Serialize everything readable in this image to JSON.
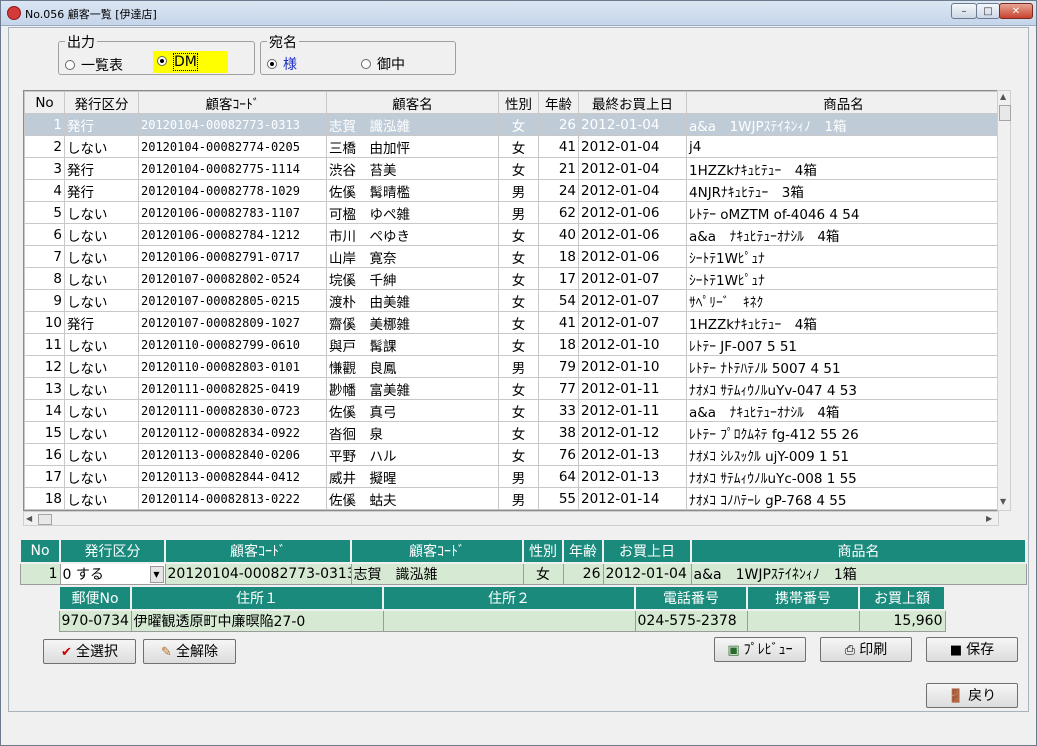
{
  "window": {
    "title": "No.056 顧客一覧 [伊達店]",
    "min": "–",
    "max": "□",
    "close": "✕"
  },
  "output_group": {
    "label": "出力",
    "options": [
      "一覧表",
      "DM"
    ],
    "selected": "DM"
  },
  "address_group": {
    "label": "宛名",
    "options": [
      "様",
      "御中"
    ],
    "selected": "様"
  },
  "grid": {
    "columns": [
      "No",
      "発行区分",
      "顧客ｺｰﾄﾞ",
      "顧客名",
      "性別",
      "年齢",
      "最終お買上日",
      "商品名"
    ],
    "rows": [
      [
        "1",
        "発行",
        "20120104-00082773-0313",
        "志賀　識泓雑",
        "女",
        "26",
        "2012-01-04",
        "a&a　1WJPｽﾃｲﾈﾝｨﾉ　1箱"
      ],
      [
        "2",
        "しない",
        "20120104-00082774-0205",
        "三橋　由加怦",
        "女",
        "41",
        "2012-01-04",
        "j4"
      ],
      [
        "3",
        "発行",
        "20120104-00082775-1114",
        "渋谷　苔美",
        "女",
        "21",
        "2012-01-04",
        "1HZZkﾅｷｭﾋﾃｭｰ　4箱"
      ],
      [
        "4",
        "発行",
        "20120104-00082778-1029",
        "佐傒　髯晴檻",
        "男",
        "24",
        "2012-01-04",
        "4NJRﾅｷｭﾋﾃｭｰ　3箱"
      ],
      [
        "5",
        "しない",
        "20120106-00082783-1107",
        "可楹　ゆペ雑",
        "男",
        "62",
        "2012-01-06",
        "ﾚﾄﾃｰ oMZTM of-4046 4 54"
      ],
      [
        "6",
        "しない",
        "20120106-00082784-1212",
        "市川　ぺゆき",
        "女",
        "40",
        "2012-01-06",
        "a&a　ﾅｷｭﾋﾃｭｰｵﾅｼﾙ　4箱"
      ],
      [
        "7",
        "しない",
        "20120106-00082791-0717",
        "山岸　寛奈",
        "女",
        "18",
        "2012-01-06",
        "ｼｰﾄﾃ1Wﾋﾟｭﾅ"
      ],
      [
        "8",
        "しない",
        "20120107-00082802-0524",
        "垸傒　千紳",
        "女",
        "17",
        "2012-01-07",
        "ｼｰﾄﾃ1Wﾋﾟｭﾅ"
      ],
      [
        "9",
        "しない",
        "20120107-00082805-0215",
        "渡朴　由美雑",
        "女",
        "54",
        "2012-01-07",
        "ｻﾍﾟﾘｰﾞ　ｷﾈｸ"
      ],
      [
        "10",
        "発行",
        "20120107-00082809-1027",
        "齋傒　美梛雑",
        "女",
        "41",
        "2012-01-07",
        "1HZZkﾅｷｭﾋﾃｭｰ　4箱"
      ],
      [
        "11",
        "しない",
        "20120110-00082799-0610",
        "與戸　髯課",
        "女",
        "18",
        "2012-01-10",
        "ﾚﾄﾃｰ JF-007 5 51"
      ],
      [
        "12",
        "しない",
        "20120110-00082803-0101",
        "慊觀　良鳳",
        "男",
        "79",
        "2012-01-10",
        "ﾚﾄﾃｰ ﾅﾄﾃﾊﾃﾉﾙ 5007 4 51"
      ],
      [
        "13",
        "しない",
        "20120111-00082825-0419",
        "尠幡　富美雑",
        "女",
        "77",
        "2012-01-11",
        "ﾅｵﾒｺ ｻﾃﾑｨｳﾉﾙuYv-047 4 53"
      ],
      [
        "14",
        "しない",
        "20120111-00082830-0723",
        "佐傒　真弓",
        "女",
        "33",
        "2012-01-11",
        "a&a　ﾅｷｭﾋﾃｭｰｵﾅｼﾙ　4箱"
      ],
      [
        "15",
        "しない",
        "20120112-00082834-0922",
        "沓徊　泉",
        "女",
        "38",
        "2012-01-12",
        "ﾚﾄﾃｰ ﾌﾟﾛｸﾑﾈﾃ fg-412 55 26"
      ],
      [
        "16",
        "しない",
        "20120113-00082840-0206",
        "平野　ハル",
        "女",
        "76",
        "2012-01-13",
        "ﾅｵﾒｺ ｼﾚｽｯｸﾙ ujY-009 1 51"
      ],
      [
        "17",
        "しない",
        "20120113-00082844-0412",
        "威井　擬暒",
        "男",
        "64",
        "2012-01-13",
        "ﾅｵﾒｺ ｻﾃﾑｨｳﾉﾙuYc-008 1 55"
      ],
      [
        "18",
        "しない",
        "20120114-00082813-0222",
        "佐傒　蛄夫",
        "男",
        "55",
        "2012-01-14",
        "ﾅｵﾒｺ ｺﾉﾊﾃｰﾚ gP-768 4 55"
      ]
    ]
  },
  "detail": {
    "columns": [
      "No",
      "発行区分",
      "顧客ｺｰﾄﾞ",
      "顧客ｺｰﾄﾞ",
      "性別",
      "年齢",
      "お買上日",
      "商品名"
    ],
    "row": {
      "no": "1",
      "issue": "0 する",
      "code": "20120104-00082773-0313",
      "name": "志賀　識泓雑",
      "sex": "女",
      "age": "26",
      "date": "2012-01-04",
      "product": "a&a　1WJPｽﾃｲﾈﾝｨﾉ　1箱"
    },
    "columns2": [
      "郵便No",
      "住所１",
      "住所２",
      "電話番号",
      "携帯番号",
      "お買上額"
    ],
    "row2": {
      "zip": "970-0734",
      "addr1": "伊曜観透原町中廉暝陥27-0",
      "addr2": "",
      "phone": "024-575-2378",
      "mobile": "",
      "amount": "15,960"
    }
  },
  "buttons": {
    "select_all": "全選択",
    "deselect_all": "全解除",
    "preview": "ﾌﾟﾚﾋﾞｭｰ",
    "print": "印刷",
    "save": "保存",
    "back": "戻り"
  },
  "colors": {
    "teal_header": "#1a8a7d",
    "green_row": "#d5e9d3",
    "selected_row": "#bfccd8",
    "dm_highlight": "#ffff00",
    "check_red": "#cc0000"
  }
}
